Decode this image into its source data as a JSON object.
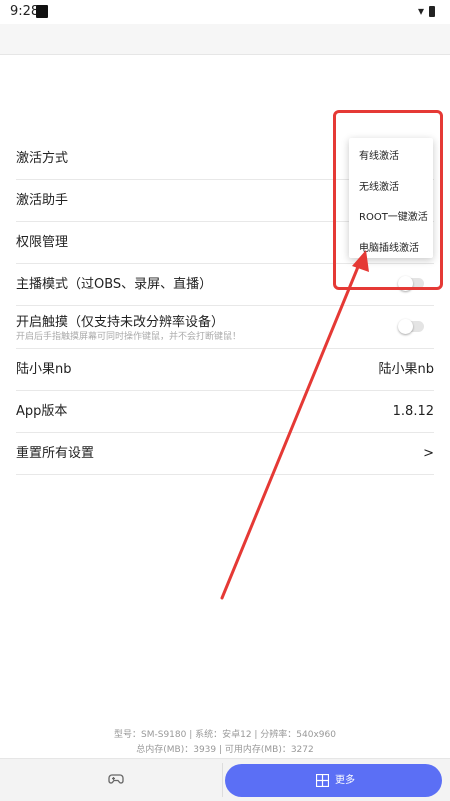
{
  "status_bar": {
    "time": "9:28"
  },
  "settings": {
    "activation_method": "激活方式",
    "activation_helper": "激活助手",
    "permission_manage": "权限管理",
    "streamer_mode": "主播模式（过OBS、录屏、直播）",
    "touch_mode": "开启触摸（仅支持未改分辨率设备）",
    "touch_mode_desc": "开启后手指触摸屏幕可同时操作键鼠，并不会打断键鼠！",
    "user_label": "陆小果nb",
    "user_value": "陆小果nb",
    "app_version_label": "App版本",
    "app_version_value": "1.8.12",
    "reset_label": "重置所有设置",
    "reset_arrow": ">"
  },
  "popup_menu": {
    "items": [
      "有线激活",
      "无线激活",
      "ROOT一键激活",
      "电脑插线激活"
    ]
  },
  "device_info": {
    "line1": "型号：SM-S9180 | 系统：安卓12 | 分辨率：540x960",
    "line2": "总内存(MB)：3939 | 可用内存(MB)：3272"
  },
  "bottom_bar": {
    "more_label": "更多",
    "gamepad_icon": "gamepad-icon",
    "more_icon": "grid-icon"
  },
  "colors": {
    "accent": "#5b6ff5",
    "annotation": "#e53935"
  }
}
